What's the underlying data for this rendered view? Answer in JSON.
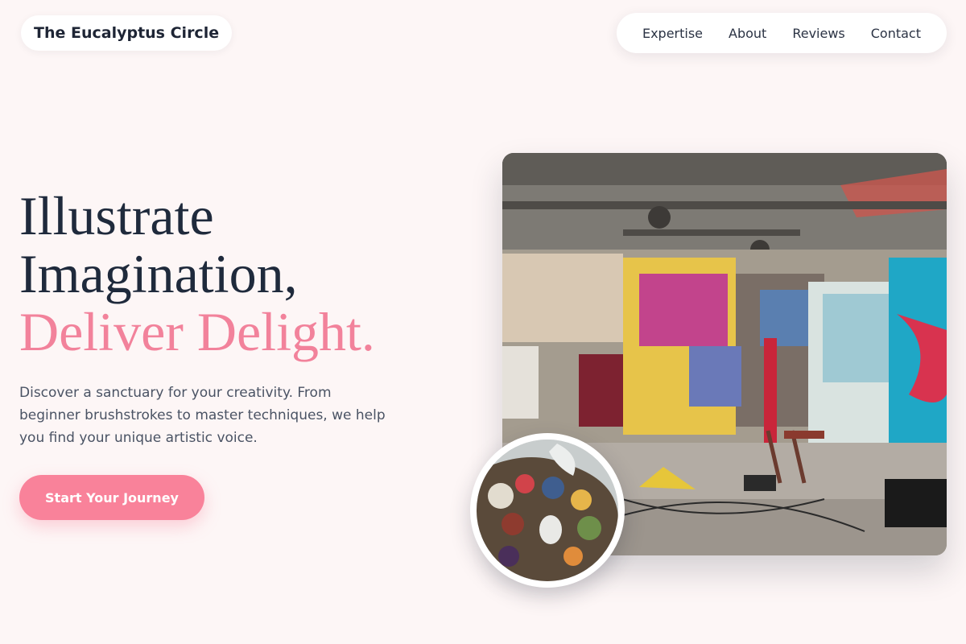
{
  "brand": {
    "name": "The Eucalyptus Circle"
  },
  "nav": {
    "items": [
      {
        "label": "Expertise"
      },
      {
        "label": "About"
      },
      {
        "label": "Reviews"
      },
      {
        "label": "Contact"
      }
    ]
  },
  "hero": {
    "headline_line1": "Illustrate",
    "headline_line2": "Imagination,",
    "headline_accent": "Deliver Delight.",
    "description": "Discover a sanctuary for your creativity. From beginner brushstrokes to master techniques, we help you find your unique artistic voice.",
    "cta_label": "Start Your Journey"
  },
  "images": {
    "studio_photo": "graffiti-art-studio-photo",
    "palette_photo": "paint-palette-photo"
  },
  "colors": {
    "background": "#fdf6f6",
    "accent": "#f9829a",
    "heading": "#1f2a3c",
    "body_text": "#4a5364"
  }
}
